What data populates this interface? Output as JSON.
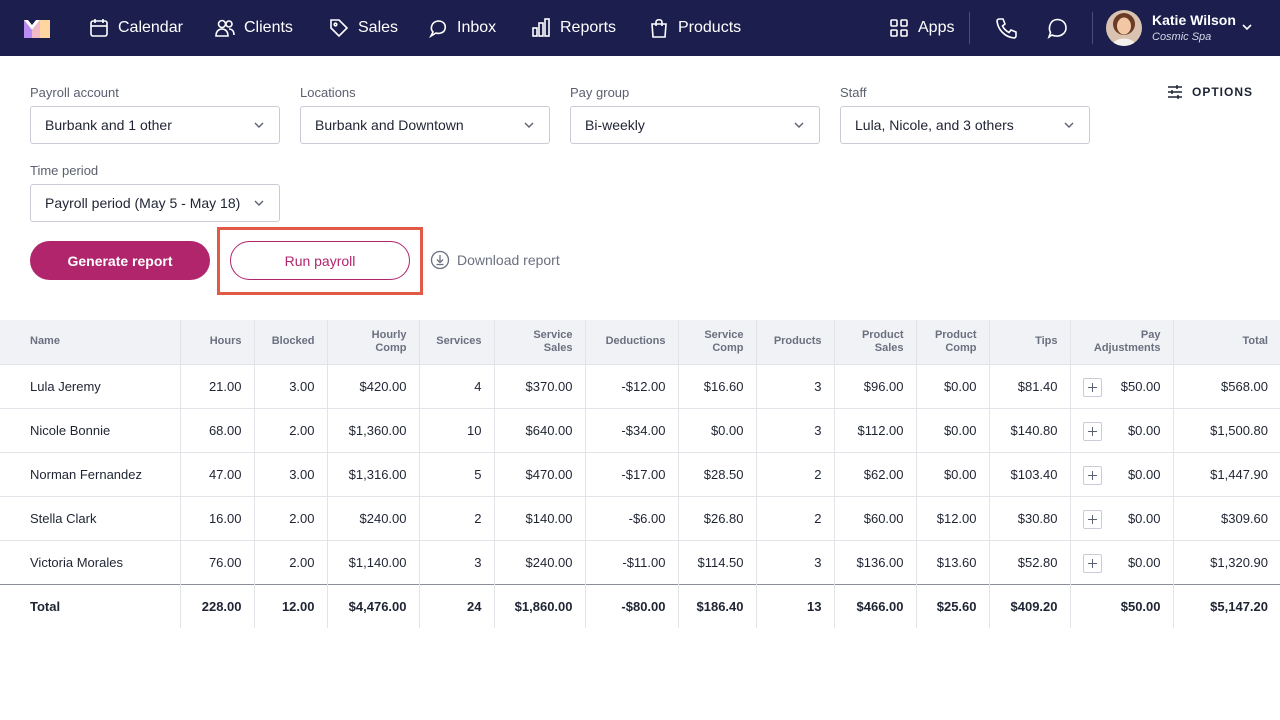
{
  "nav": {
    "items": [
      {
        "label": "Calendar",
        "icon": "calendar-icon"
      },
      {
        "label": "Clients",
        "icon": "users-icon"
      },
      {
        "label": "Sales",
        "icon": "tag-icon"
      },
      {
        "label": "Inbox",
        "icon": "chat-bubble-icon"
      },
      {
        "label": "Reports",
        "icon": "bar-chart-icon"
      },
      {
        "label": "Products",
        "icon": "shopping-bag-icon"
      }
    ],
    "apps_label": "Apps",
    "user": {
      "name": "Katie Wilson",
      "org": "Cosmic Spa"
    }
  },
  "filters": {
    "payroll_account": {
      "label": "Payroll account",
      "value": "Burbank and 1 other"
    },
    "locations": {
      "label": "Locations",
      "value": "Burbank and Downtown"
    },
    "pay_group": {
      "label": "Pay group",
      "value": "Bi-weekly"
    },
    "staff": {
      "label": "Staff",
      "value": "Lula, Nicole, and 3 others"
    },
    "time_period": {
      "label": "Time period",
      "value": "Payroll period (May 5 - May 18)"
    }
  },
  "options_label": "OPTIONS",
  "actions": {
    "generate": "Generate report",
    "run_payroll": "Run payroll",
    "download": "Download report"
  },
  "table": {
    "headers": {
      "name": "Name",
      "hours": "Hours",
      "blocked": "Blocked",
      "hourly_comp": [
        "Hourly",
        "Comp"
      ],
      "services": "Services",
      "service_sales": [
        "Service",
        "Sales"
      ],
      "deductions": "Deductions",
      "service_comp": [
        "Service",
        "Comp"
      ],
      "products": "Products",
      "product_sales": [
        "Product",
        "Sales"
      ],
      "product_comp": [
        "Product",
        "Comp"
      ],
      "tips": "Tips",
      "pay_adjustments": [
        "Pay",
        "Adjustments"
      ],
      "total": "Total"
    },
    "rows": [
      {
        "name": "Lula Jeremy",
        "hours": "21.00",
        "blocked": "3.00",
        "hourly_comp": "$420.00",
        "services": "4",
        "service_sales": "$370.00",
        "deductions": "-$12.00",
        "service_comp": "$16.60",
        "products": "3",
        "product_sales": "$96.00",
        "product_comp": "$0.00",
        "tips": "$81.40",
        "pay_adjustments": "$50.00",
        "total": "$568.00"
      },
      {
        "name": "Nicole Bonnie",
        "hours": "68.00",
        "blocked": "2.00",
        "hourly_comp": "$1,360.00",
        "services": "10",
        "service_sales": "$640.00",
        "deductions": "-$34.00",
        "service_comp": "$0.00",
        "products": "3",
        "product_sales": "$112.00",
        "product_comp": "$0.00",
        "tips": "$140.80",
        "pay_adjustments": "$0.00",
        "total": "$1,500.80"
      },
      {
        "name": "Norman Fernandez",
        "hours": "47.00",
        "blocked": "3.00",
        "hourly_comp": "$1,316.00",
        "services": "5",
        "service_sales": "$470.00",
        "deductions": "-$17.00",
        "service_comp": "$28.50",
        "products": "2",
        "product_sales": "$62.00",
        "product_comp": "$0.00",
        "tips": "$103.40",
        "pay_adjustments": "$0.00",
        "total": "$1,447.90"
      },
      {
        "name": "Stella Clark",
        "hours": "16.00",
        "blocked": "2.00",
        "hourly_comp": "$240.00",
        "services": "2",
        "service_sales": "$140.00",
        "deductions": "-$6.00",
        "service_comp": "$26.80",
        "products": "2",
        "product_sales": "$60.00",
        "product_comp": "$12.00",
        "tips": "$30.80",
        "pay_adjustments": "$0.00",
        "total": "$309.60"
      },
      {
        "name": "Victoria Morales",
        "hours": "76.00",
        "blocked": "2.00",
        "hourly_comp": "$1,140.00",
        "services": "3",
        "service_sales": "$240.00",
        "deductions": "-$11.00",
        "service_comp": "$114.50",
        "products": "3",
        "product_sales": "$136.00",
        "product_comp": "$13.60",
        "tips": "$52.80",
        "pay_adjustments": "$0.00",
        "total": "$1,320.90"
      }
    ],
    "totals": {
      "name": "Total",
      "hours": "228.00",
      "blocked": "12.00",
      "hourly_comp": "$4,476.00",
      "services": "24",
      "service_sales": "$1,860.00",
      "deductions": "-$80.00",
      "service_comp": "$186.40",
      "products": "13",
      "product_sales": "$466.00",
      "product_comp": "$25.60",
      "tips": "$409.20",
      "pay_adjustments": "$50.00",
      "total": "$5,147.20"
    }
  },
  "colors": {
    "nav_bg": "#1c1f4d",
    "accent": "#b1256d",
    "highlight": "#e05a46"
  }
}
